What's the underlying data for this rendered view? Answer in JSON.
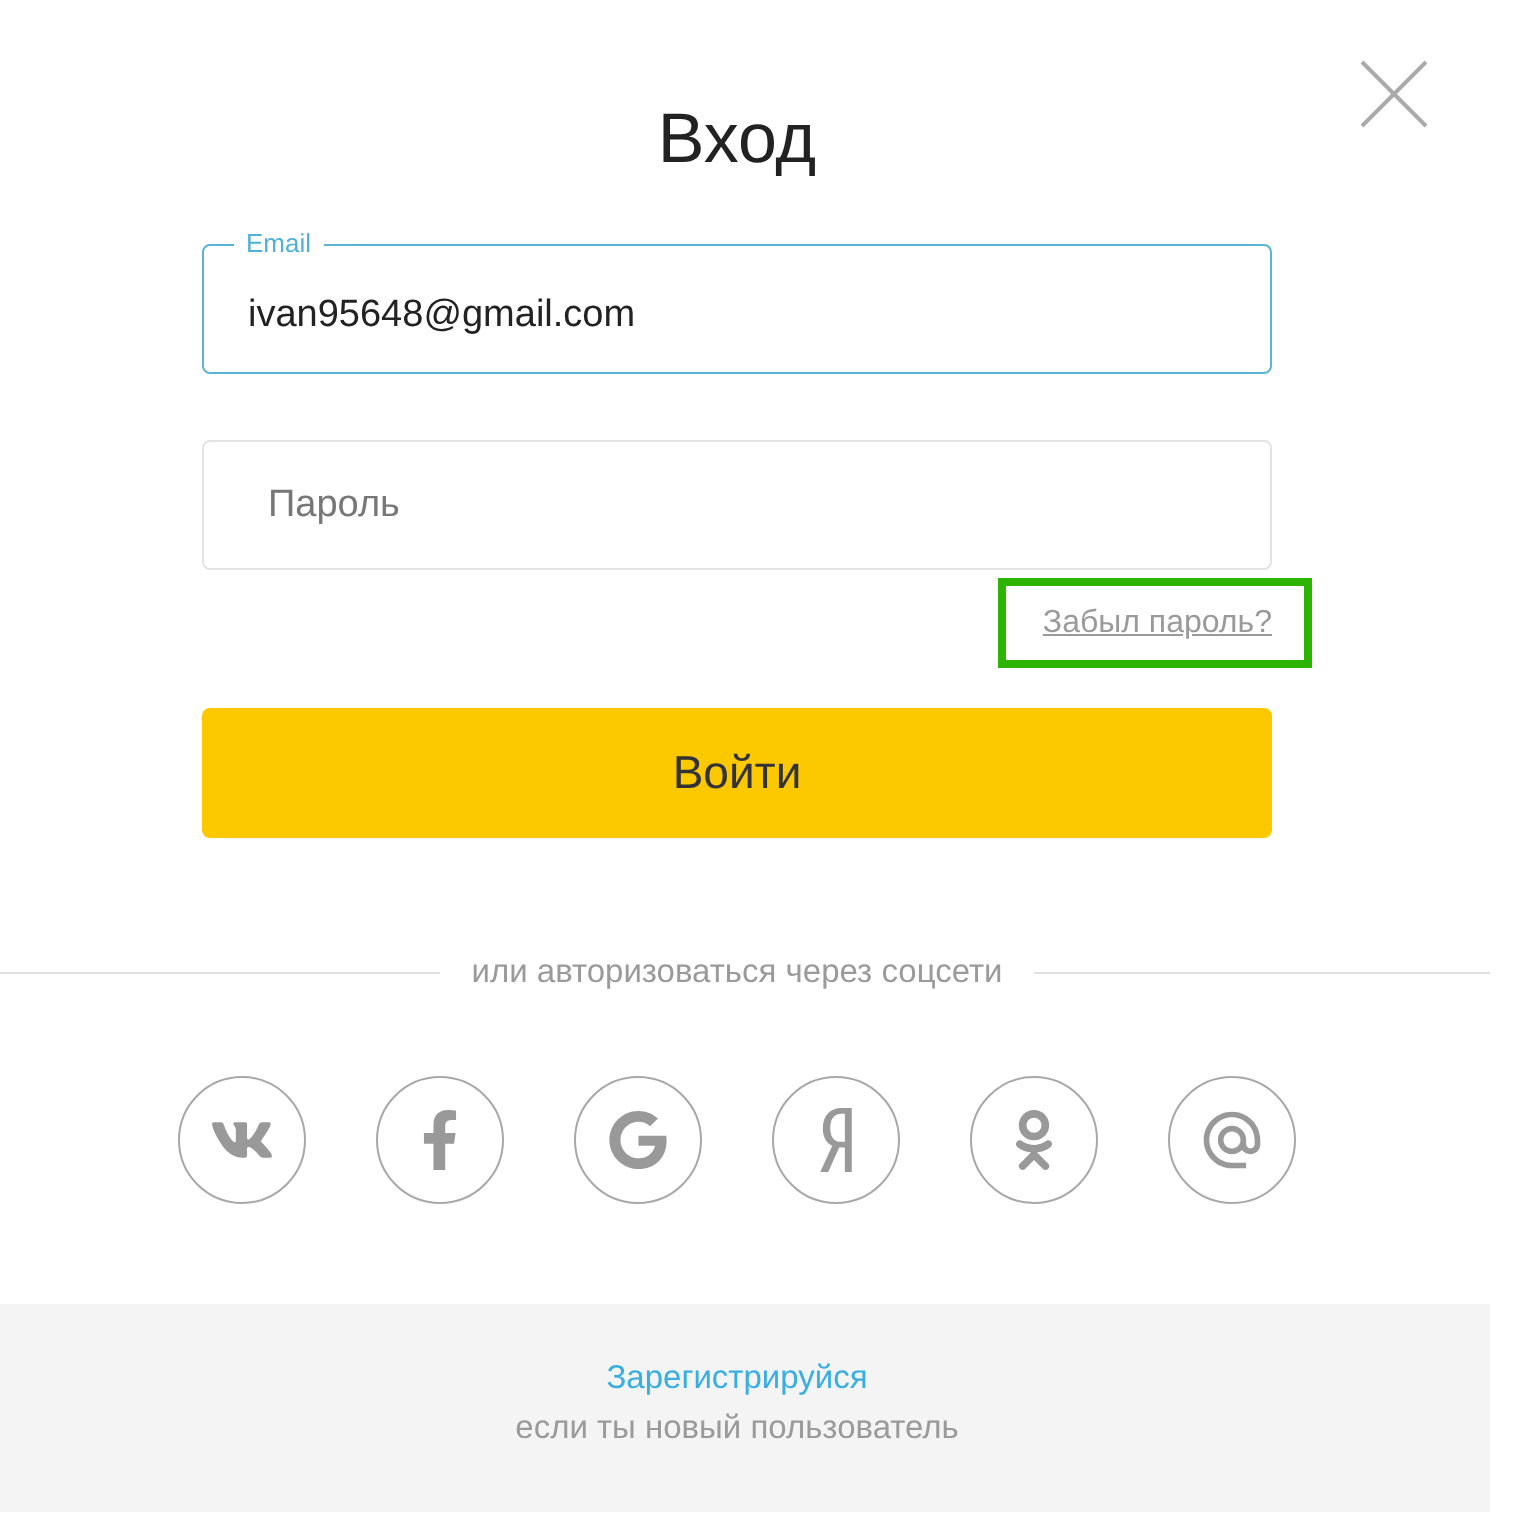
{
  "dialog": {
    "title": "Вход"
  },
  "email_field": {
    "label": "Email",
    "value": "ivan95648@gmail.com",
    "focused": true
  },
  "password_field": {
    "placeholder": "Пароль"
  },
  "forgot_password_link": {
    "text": "Забыл пароль?",
    "highlighted": true
  },
  "login_button": {
    "label": "Войти"
  },
  "social_divider": {
    "text": "или авторизоваться через соцсети"
  },
  "social_buttons": [
    {
      "kind": "vk"
    },
    {
      "kind": "facebook"
    },
    {
      "kind": "google"
    },
    {
      "kind": "yandex"
    },
    {
      "kind": "odnoklassniki"
    },
    {
      "kind": "mail"
    }
  ],
  "register": {
    "link": "Зарегистрируйся",
    "note": "если ты новый пользователь"
  }
}
